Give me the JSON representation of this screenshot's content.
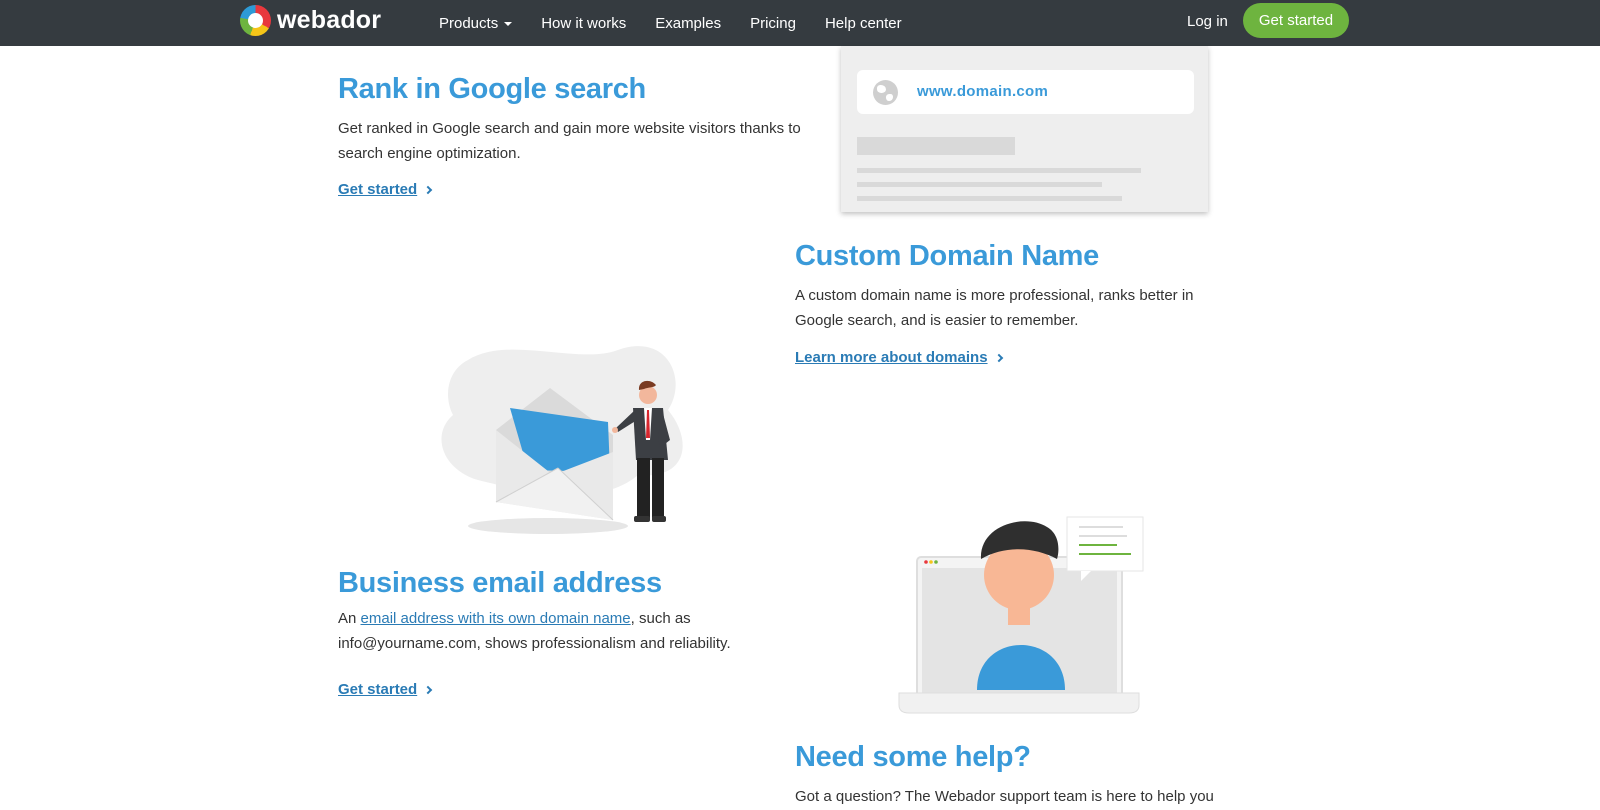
{
  "brand": {
    "name": "webador"
  },
  "nav": {
    "items": [
      {
        "label": "Products",
        "has_dropdown": true
      },
      {
        "label": "How it works"
      },
      {
        "label": "Examples"
      },
      {
        "label": "Pricing"
      },
      {
        "label": "Help center"
      }
    ],
    "login_label": "Log in",
    "cta_label": "Get started"
  },
  "sections": {
    "google": {
      "title": "Rank in Google search",
      "text": "Get ranked in Google search and gain more website visitors thanks to search engine optimization.",
      "link": "Get started"
    },
    "domain": {
      "url": "www.domain.com",
      "title": "Custom Domain Name",
      "text": "A custom domain name is more professional, ranks better in Google search, and is easier to remember.",
      "link": "Learn more about domains"
    },
    "email": {
      "title": "Business email address",
      "text_before": "An ",
      "link_inline": "email address with its own domain name",
      "text_after": ", such as info@yourname.com, shows professionalism and reliability.",
      "link": "Get started"
    },
    "help": {
      "title": "Need some help?",
      "text": "Got a question? The Webador support team is here to help you"
    }
  },
  "colors": {
    "nav_bg": "#353b40",
    "accent_blue": "#3a9ad9",
    "link_blue": "#2a7bb5",
    "cta_green": "#6eb43f"
  }
}
